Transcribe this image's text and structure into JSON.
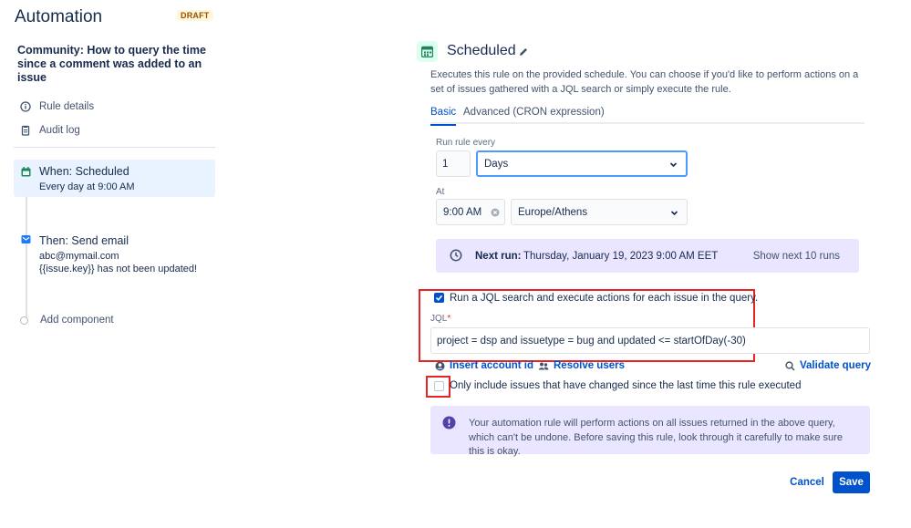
{
  "sidebar": {
    "app_title": "Automation",
    "badge": "DRAFT",
    "rule_name": "Community: How to query the time since a comment was added to an issue",
    "links": [
      {
        "label": "Rule details",
        "icon": "info-icon"
      },
      {
        "label": "Audit log",
        "icon": "clipboard-icon"
      }
    ],
    "steps": [
      {
        "title": "When: Scheduled",
        "lines": [
          "Every day at 9:00 AM"
        ],
        "icon": "calendar-icon"
      },
      {
        "title": "Then: Send email",
        "lines": [
          "abc@mymail.com",
          "{{issue.key}} has not been updated!"
        ],
        "icon": "mail-icon"
      }
    ],
    "add_component": "Add component"
  },
  "main": {
    "title": "Scheduled",
    "description": "Executes this rule on the provided schedule. You can choose if you'd like to perform actions on a set of issues gathered with a JQL search or simply execute the rule.",
    "tabs": [
      "Basic",
      "Advanced (CRON expression)"
    ],
    "active_tab": "Basic",
    "run_every_label": "Run rule every",
    "interval_value": "1",
    "interval_unit": "Days",
    "at_label": "At",
    "time_value": "9:00 AM",
    "timezone": "Europe/Athens",
    "next_run_label": "Next run:",
    "next_run_value": "Thursday, January 19, 2023 9:00 AM EET",
    "show_next_label": "Show next 10 runs",
    "jql_checkbox_label": "Run a JQL search and execute actions for each issue in the query.",
    "jql_checkbox_checked": true,
    "jql_label": "JQL",
    "jql_required_mark": "*",
    "jql_value": "project = dsp and issuetype = bug and updated <= startOfDay(-30)",
    "insert_account_label": "Insert account id",
    "resolve_users_label": "Resolve users",
    "validate_query_label": "Validate query",
    "only_changed_label": "Only include issues that have changed since the last time this rule executed",
    "only_changed_checked": false,
    "warning_text": "Your automation rule will perform actions on all issues returned in the above query, which can't be undone. Before saving this rule, look through it carefully to make sure this is okay.",
    "cancel_label": "Cancel",
    "save_label": "Save"
  },
  "colors": {
    "primary": "#0052cc",
    "selected_step_bg": "#e9f2ff",
    "info_panel_bg": "#eae6ff",
    "annotation_red": "#e52521",
    "scheduled_icon_bg": "#dcfff1",
    "scheduled_icon_fg": "#1f845a",
    "warning_icon": "#5243aa"
  }
}
